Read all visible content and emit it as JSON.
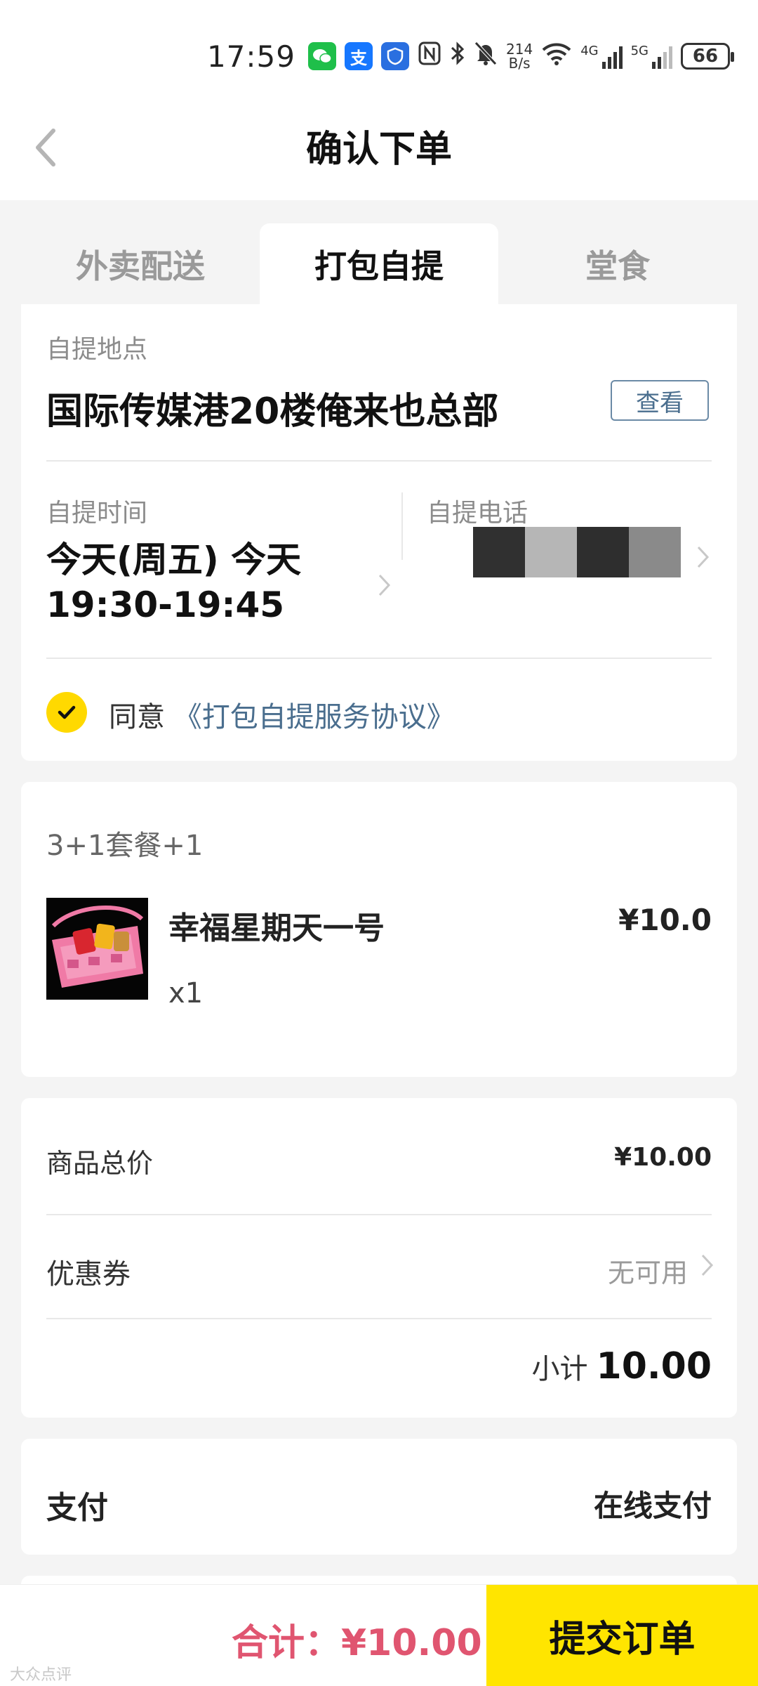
{
  "status_bar": {
    "time": "17:59",
    "net_speed_top": "214",
    "net_speed_bottom": "B/s",
    "net1": "4G",
    "net2": "5G",
    "battery": "66",
    "app_icons": [
      "wechat-icon",
      "alipay-icon",
      "shield-icon"
    ]
  },
  "header": {
    "title": "确认下单"
  },
  "tabs": [
    {
      "label": "外卖配送",
      "active": false
    },
    {
      "label": "打包自提",
      "active": true
    },
    {
      "label": "堂食",
      "active": false
    }
  ],
  "pickup": {
    "location_label": "自提地点",
    "address": "国际传媒港20楼俺来也总部",
    "view_button": "查看",
    "time_label": "自提时间",
    "time_value": "今天(周五) 今天 19:30-19:45",
    "phone_label": "自提电话",
    "agree_text": "同意",
    "agree_link": "《打包自提服务协议》"
  },
  "order_item": {
    "combo_title": "3+1套餐+1",
    "name": "幸福星期天一号",
    "price": "¥10.0",
    "quantity": "x1"
  },
  "price_summary": {
    "goods_total_label": "商品总价",
    "goods_total_value": "¥10.00",
    "coupon_label": "优惠券",
    "coupon_value": "无可用",
    "subtotal_label": "小计",
    "subtotal_value": "10.00"
  },
  "payment": {
    "label": "支付",
    "value": "在线支付"
  },
  "footer": {
    "total_text": "合计：¥10.00",
    "submit_label": "提交订单"
  },
  "watermark": "大众点评",
  "colors": {
    "accent_yellow": "#ffe500",
    "total_pink": "#e05570",
    "link_blue": "#4a6e8e"
  }
}
